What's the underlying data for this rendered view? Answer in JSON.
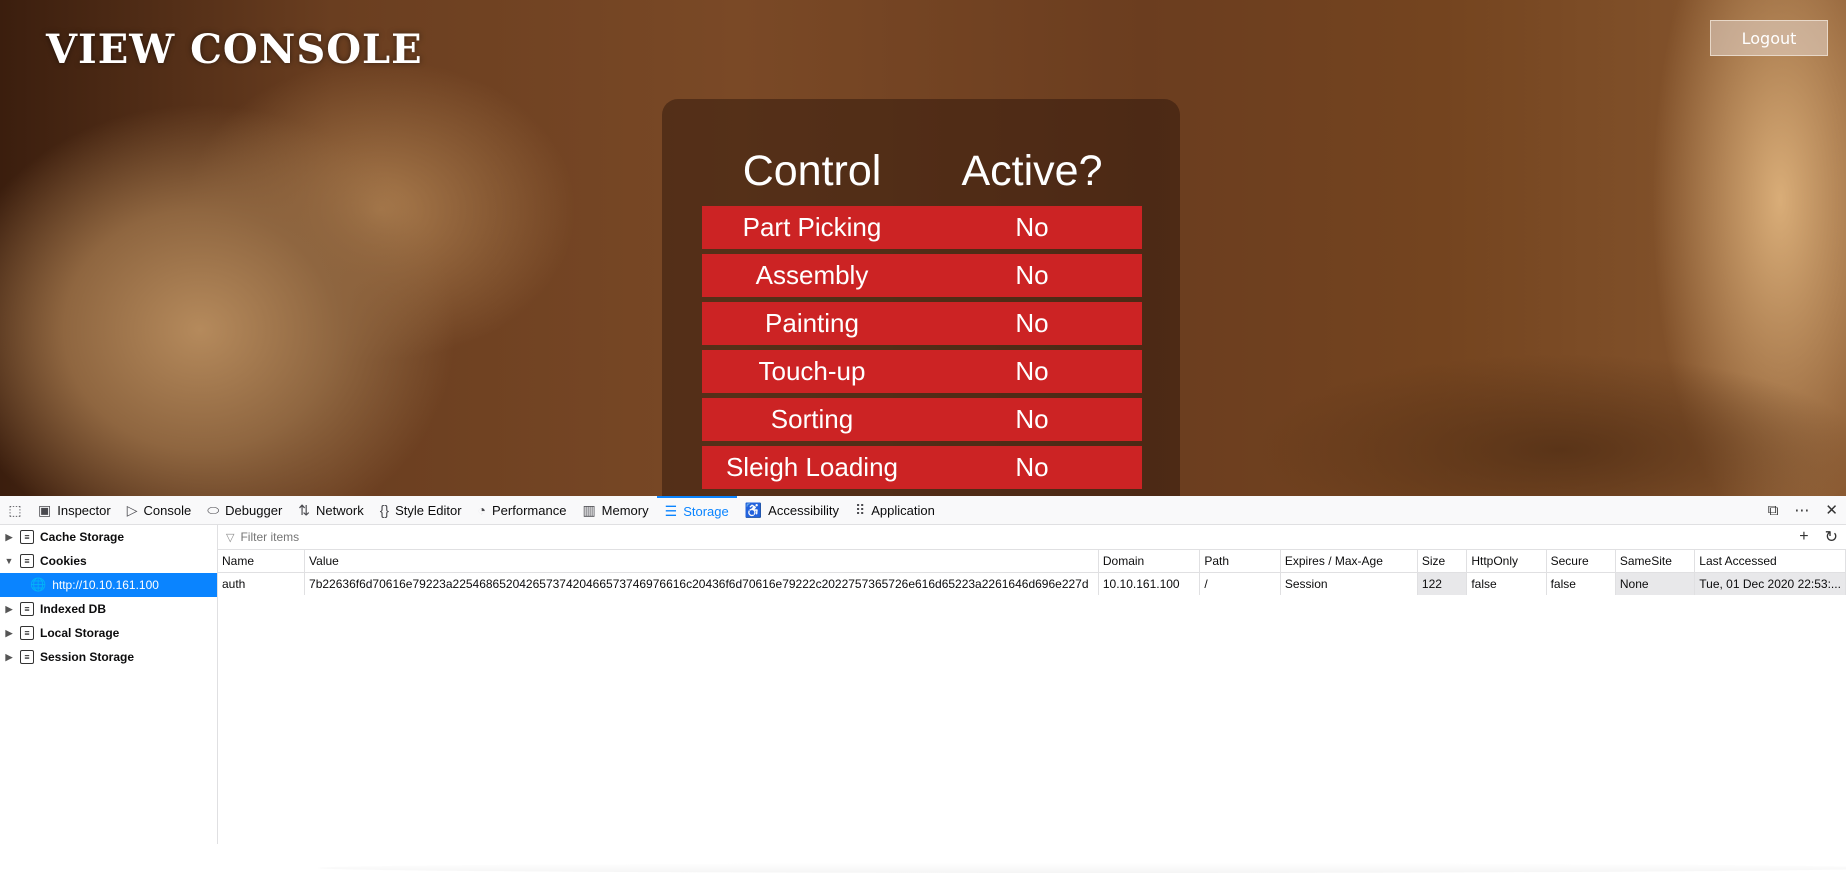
{
  "page": {
    "title": "VIEW CONSOLE",
    "logout_label": "Logout",
    "table": {
      "headers": [
        "Control",
        "Active?"
      ],
      "rows": [
        {
          "control": "Part Picking",
          "active": "No"
        },
        {
          "control": "Assembly",
          "active": "No"
        },
        {
          "control": "Painting",
          "active": "No"
        },
        {
          "control": "Touch-up",
          "active": "No"
        },
        {
          "control": "Sorting",
          "active": "No"
        },
        {
          "control": "Sleigh Loading",
          "active": "No"
        }
      ]
    }
  },
  "devtools": {
    "tabs": [
      {
        "label": "Inspector",
        "icon": "inspector-icon"
      },
      {
        "label": "Console",
        "icon": "console-icon"
      },
      {
        "label": "Debugger",
        "icon": "debugger-icon"
      },
      {
        "label": "Network",
        "icon": "network-icon"
      },
      {
        "label": "Style Editor",
        "icon": "style-editor-icon"
      },
      {
        "label": "Performance",
        "icon": "performance-icon"
      },
      {
        "label": "Memory",
        "icon": "memory-icon"
      },
      {
        "label": "Storage",
        "icon": "storage-icon",
        "active": true
      },
      {
        "label": "Accessibility",
        "icon": "accessibility-icon"
      },
      {
        "label": "Application",
        "icon": "application-icon"
      }
    ],
    "sidebar": {
      "items": [
        "Cache Storage",
        "Cookies",
        "Indexed DB",
        "Local Storage",
        "Session Storage"
      ],
      "cookies_host": "http://10.10.161.100"
    },
    "filter_placeholder": "Filter items",
    "columns": [
      "Name",
      "Value",
      "Domain",
      "Path",
      "Expires / Max-Age",
      "Size",
      "HttpOnly",
      "Secure",
      "SameSite",
      "Last Accessed"
    ],
    "cookie": {
      "name": "auth",
      "value": "7b22636f6d70616e79223a22546865204265737420466573746976616c20436f6d70616e79222c2022757365726e616d65223a2261646d696e227d",
      "domain": "10.10.161.100",
      "path": "/",
      "expires": "Session",
      "size": "122",
      "httponly": "false",
      "secure": "false",
      "samesite": "None",
      "last_accessed": "Tue, 01 Dec 2020 22:53:..."
    },
    "colors": {
      "accent": "#0a84ff",
      "row_red": "#cc2324"
    }
  }
}
